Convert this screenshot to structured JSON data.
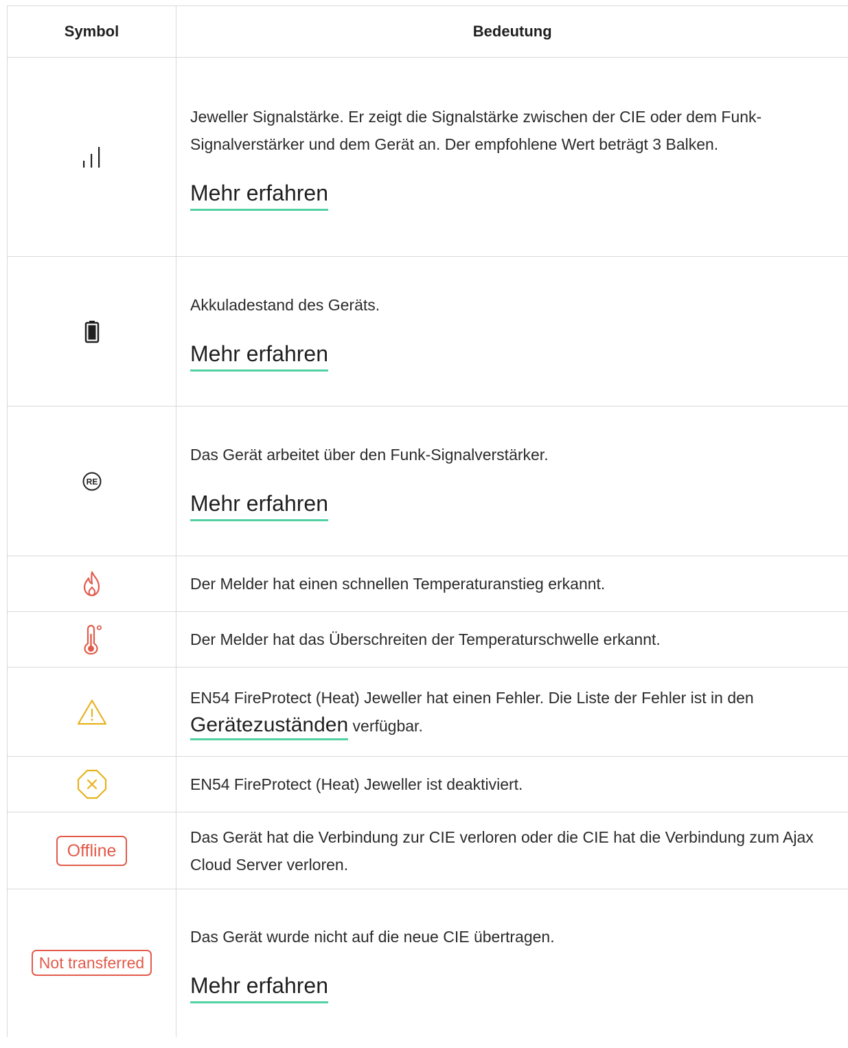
{
  "table": {
    "headers": {
      "symbol": "Symbol",
      "meaning": "Bedeutung"
    },
    "rows": [
      {
        "icon": "signal-strength-icon",
        "text": "Jeweller Signalstärke. Er zeigt die Signalstärke zwischen der CIE oder dem Funk-Signalverstärker und dem Gerät an. Der empfohlene Wert beträgt 3 Balken.",
        "link": "Mehr erfahren"
      },
      {
        "icon": "battery-icon",
        "text": "Akkuladestand des Geräts.",
        "link": "Mehr erfahren"
      },
      {
        "icon": "range-extender-icon",
        "icon_text": "RE",
        "text": "Das Gerät arbeitet über den Funk-Signalverstärker.",
        "link": "Mehr erfahren"
      },
      {
        "icon": "flame-icon",
        "text": "Der Melder hat einen schnellen Temperaturanstieg erkannt."
      },
      {
        "icon": "thermometer-icon",
        "text": "Der Melder hat das Überschreiten der Temperaturschwelle erkannt."
      },
      {
        "icon": "warning-icon",
        "text_before": "EN54 FireProtect (Heat) Jeweller hat einen Fehler. Die Liste der Fehler ist in den",
        "link": "Gerätezuständen",
        "text_after": "verfügbar."
      },
      {
        "icon": "deactivated-icon",
        "text": "EN54 FireProtect (Heat) Jeweller ist deaktiviert."
      },
      {
        "badge": "Offline",
        "text": "Das Gerät hat die Verbindung zur CIE verloren oder die CIE hat die Verbindung zum Ajax Cloud Server verloren."
      },
      {
        "badge": "Not transferred",
        "text": "Das Gerät wurde nicht auf die neue CIE übertragen.",
        "link": "Mehr erfahren"
      }
    ]
  },
  "colors": {
    "link_underline": "#4fd1a1",
    "alert_red": "#e25a4a",
    "warning_yellow": "#e8b21e",
    "border": "#d9d9d9"
  }
}
